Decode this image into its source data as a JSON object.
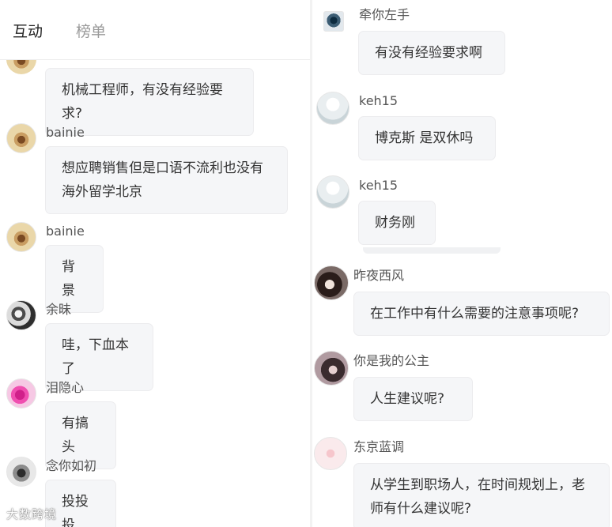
{
  "tabs": [
    {
      "label": "互动",
      "active": true
    },
    {
      "label": "榜单",
      "active": false
    }
  ],
  "left_messages": [
    {
      "user": "bainie",
      "text": "想应聘销售但是口语不流利也没有海外留学北京"
    },
    {
      "user": "bainie",
      "text": "背景"
    },
    {
      "user": "余昧",
      "text": "哇，下血本了"
    },
    {
      "user": "泪隐心",
      "text": "有搞头"
    },
    {
      "user": "念你如初",
      "text": "投投投"
    }
  ],
  "left_top_partial_text": "机械工程师，有没有经验要求?",
  "right_messages": [
    {
      "user": "牵你左手",
      "text": "有没有经验要求啊"
    },
    {
      "user": "keh15",
      "text": "博克斯 是双休吗"
    },
    {
      "user": "keh15",
      "text": "财务刚"
    },
    {
      "user": "昨夜西风",
      "text": "在工作中有什么需要的注意事项呢?"
    },
    {
      "user": "你是我的公主",
      "text": "人生建议呢?"
    },
    {
      "user": "东京蓝调",
      "text": "从学生到职场人，在时间规划上，老师有什么建议呢?"
    }
  ],
  "watermark": "大数跨境",
  "colors": {
    "bubble_bg": "#f5f6f8",
    "active_tab": "#222222",
    "inactive_tab": "#9a9a9a"
  }
}
